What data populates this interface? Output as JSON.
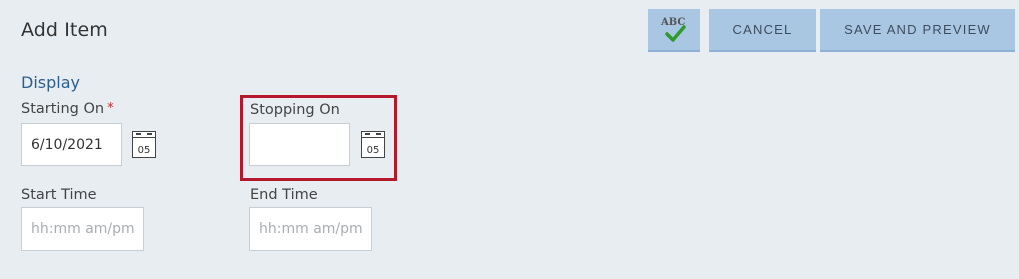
{
  "header": {
    "title": "Add Item"
  },
  "toolbar": {
    "spellcheck_label": "ABC",
    "spellcheck_icon": "spellcheck-icon",
    "cancel_label": "CANCEL",
    "save_preview_label": "SAVE AND PREVIEW"
  },
  "section": {
    "heading": "Display"
  },
  "fields": {
    "starting_on": {
      "label": "Starting On",
      "required_marker": "*",
      "value": "6/10/2021",
      "calendar_day": "05"
    },
    "stopping_on": {
      "label": "Stopping On",
      "value": "",
      "calendar_day": "05"
    },
    "start_time": {
      "label": "Start Time",
      "placeholder": "hh:mm am/pm"
    },
    "end_time": {
      "label": "End Time",
      "placeholder": "hh:mm am/pm"
    }
  },
  "colors": {
    "background": "#e8edf2",
    "button": "#a9c6e3",
    "heading_blue": "#2a5f90",
    "highlight_red": "#b5172b",
    "required_red": "#c62828",
    "check_green": "#2e9b2e"
  }
}
